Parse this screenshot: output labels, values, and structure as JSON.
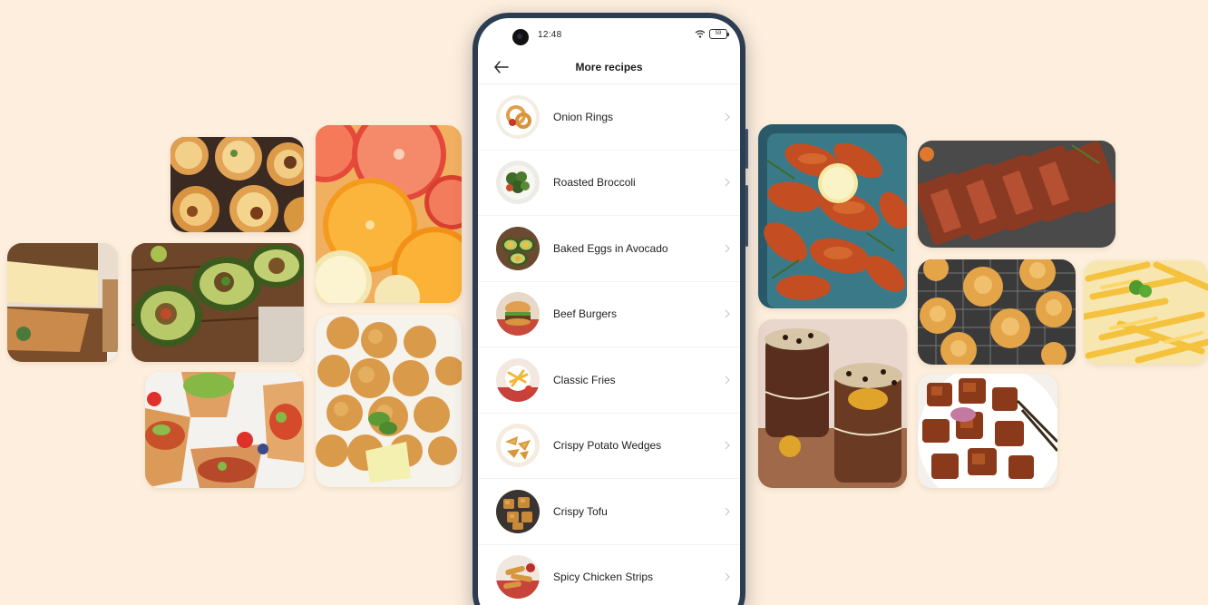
{
  "status_bar": {
    "time": "12:48",
    "battery": "59"
  },
  "header": {
    "title": "More recipes"
  },
  "recipes": [
    {
      "label": "Onion Rings",
      "icon": "onion-rings"
    },
    {
      "label": "Roasted Broccoli",
      "icon": "roasted-broccoli"
    },
    {
      "label": "Baked Eggs in Avocado",
      "icon": "baked-eggs-avocado"
    },
    {
      "label": "Beef Burgers",
      "icon": "beef-burgers"
    },
    {
      "label": "Classic Fries",
      "icon": "classic-fries"
    },
    {
      "label": "Crispy Potato Wedges",
      "icon": "potato-wedges"
    },
    {
      "label": "Crispy Tofu",
      "icon": "crispy-tofu"
    },
    {
      "label": "Spicy Chicken Strips",
      "icon": "chicken-strips"
    }
  ],
  "colors": {
    "background": "#fdeedd",
    "phone_frame": "#2c3d52",
    "screen": "#ffffff",
    "text": "#222222",
    "chevron": "#c8c8c8"
  },
  "tiles": [
    "egg-tarts",
    "cheesecake",
    "avocado-halves",
    "avocado-cups",
    "citrus-slices",
    "fried-chicken-bites",
    "grilled-wings",
    "chocolate-cups",
    "steak-slices",
    "cream-puffs",
    "french-fries",
    "braised-pork"
  ]
}
